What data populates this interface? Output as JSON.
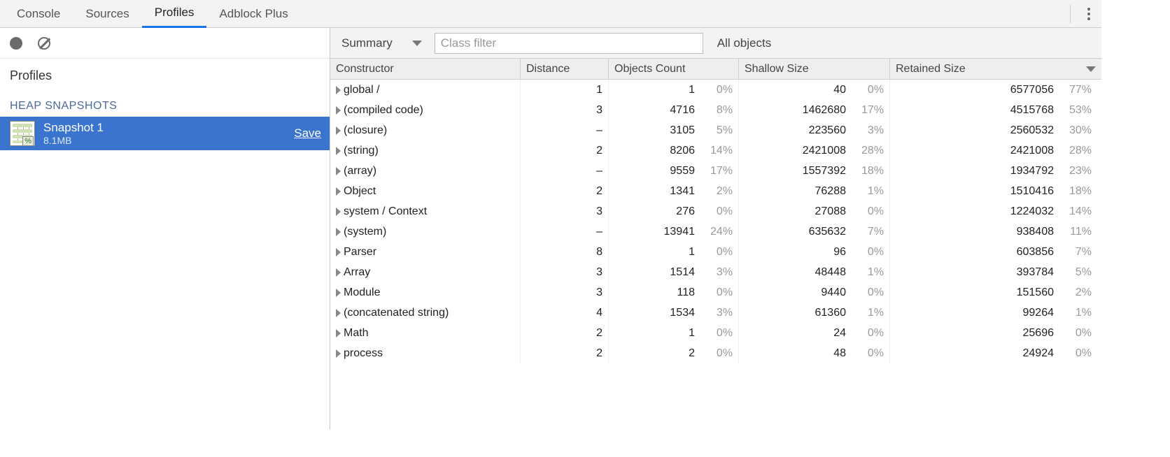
{
  "tabs": {
    "items": [
      {
        "label": "Console",
        "active": false
      },
      {
        "label": "Sources",
        "active": false
      },
      {
        "label": "Profiles",
        "active": true
      },
      {
        "label": "Adblock Plus",
        "active": false
      }
    ]
  },
  "sidebar": {
    "title": "Profiles",
    "section_label": "HEAP SNAPSHOTS",
    "snapshot": {
      "name": "Snapshot 1",
      "size": "8.1MB",
      "save_label": "Save"
    }
  },
  "toolbar": {
    "view_label": "Summary",
    "filter_placeholder": "Class filter",
    "objects_label": "All objects"
  },
  "table": {
    "headers": {
      "constructor": "Constructor",
      "distance": "Distance",
      "objects_count": "Objects Count",
      "shallow": "Shallow Size",
      "retained": "Retained Size"
    },
    "rows": [
      {
        "constructor": "global /",
        "distance": "1",
        "obj_count": "1",
        "obj_pct": "0%",
        "shallow": "40",
        "shallow_pct": "0%",
        "retained": "6577056",
        "retained_pct": "77%"
      },
      {
        "constructor": "(compiled code)",
        "distance": "3",
        "obj_count": "4716",
        "obj_pct": "8%",
        "shallow": "1462680",
        "shallow_pct": "17%",
        "retained": "4515768",
        "retained_pct": "53%"
      },
      {
        "constructor": "(closure)",
        "distance": "–",
        "obj_count": "3105",
        "obj_pct": "5%",
        "shallow": "223560",
        "shallow_pct": "3%",
        "retained": "2560532",
        "retained_pct": "30%"
      },
      {
        "constructor": "(string)",
        "distance": "2",
        "obj_count": "8206",
        "obj_pct": "14%",
        "shallow": "2421008",
        "shallow_pct": "28%",
        "retained": "2421008",
        "retained_pct": "28%"
      },
      {
        "constructor": "(array)",
        "distance": "–",
        "obj_count": "9559",
        "obj_pct": "17%",
        "shallow": "1557392",
        "shallow_pct": "18%",
        "retained": "1934792",
        "retained_pct": "23%"
      },
      {
        "constructor": "Object",
        "distance": "2",
        "obj_count": "1341",
        "obj_pct": "2%",
        "shallow": "76288",
        "shallow_pct": "1%",
        "retained": "1510416",
        "retained_pct": "18%"
      },
      {
        "constructor": "system / Context",
        "distance": "3",
        "obj_count": "276",
        "obj_pct": "0%",
        "shallow": "27088",
        "shallow_pct": "0%",
        "retained": "1224032",
        "retained_pct": "14%"
      },
      {
        "constructor": "(system)",
        "distance": "–",
        "obj_count": "13941",
        "obj_pct": "24%",
        "shallow": "635632",
        "shallow_pct": "7%",
        "retained": "938408",
        "retained_pct": "11%"
      },
      {
        "constructor": "Parser",
        "distance": "8",
        "obj_count": "1",
        "obj_pct": "0%",
        "shallow": "96",
        "shallow_pct": "0%",
        "retained": "603856",
        "retained_pct": "7%"
      },
      {
        "constructor": "Array",
        "distance": "3",
        "obj_count": "1514",
        "obj_pct": "3%",
        "shallow": "48448",
        "shallow_pct": "1%",
        "retained": "393784",
        "retained_pct": "5%"
      },
      {
        "constructor": "Module",
        "distance": "3",
        "obj_count": "118",
        "obj_pct": "0%",
        "shallow": "9440",
        "shallow_pct": "0%",
        "retained": "151560",
        "retained_pct": "2%"
      },
      {
        "constructor": "(concatenated string)",
        "distance": "4",
        "obj_count": "1534",
        "obj_pct": "3%",
        "shallow": "61360",
        "shallow_pct": "1%",
        "retained": "99264",
        "retained_pct": "1%"
      },
      {
        "constructor": "Math",
        "distance": "2",
        "obj_count": "1",
        "obj_pct": "0%",
        "shallow": "24",
        "shallow_pct": "0%",
        "retained": "25696",
        "retained_pct": "0%"
      },
      {
        "constructor": "process",
        "distance": "2",
        "obj_count": "2",
        "obj_pct": "0%",
        "shallow": "48",
        "shallow_pct": "0%",
        "retained": "24924",
        "retained_pct": "0%"
      }
    ]
  }
}
